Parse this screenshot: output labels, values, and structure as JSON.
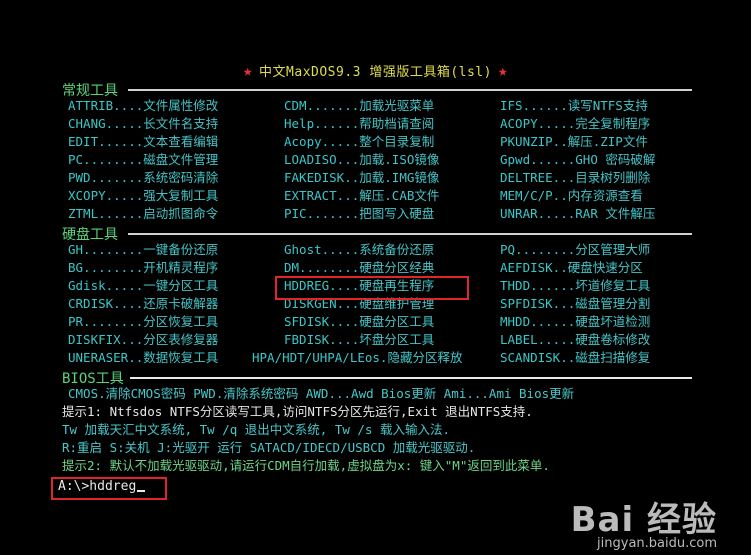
{
  "title": "中文MaxDOS9.3 增强版工具箱(lsl)",
  "sections": {
    "common": "常规工具",
    "disk": "硬盘工具",
    "bios": "BIOS工具"
  },
  "common_items": [
    {
      "k": "ATTRIB....",
      "d": "文件属性修改"
    },
    {
      "k": "CDM.......",
      "d": "加载光驱菜单"
    },
    {
      "k": "IFS......",
      "d": "读写NTFS支持"
    },
    {
      "k": "CHANG.....",
      "d": "长文件名支持"
    },
    {
      "k": "Help......",
      "d": "帮助档请查阅"
    },
    {
      "k": "ACOPY.....",
      "d": "完全复制程序"
    },
    {
      "k": "EDIT......",
      "d": "文本查看编辑"
    },
    {
      "k": "Acopy.....",
      "d": "整个目录复制"
    },
    {
      "k": "PKUNZIP..",
      "d": "解压.ZIP文件"
    },
    {
      "k": "PC........",
      "d": "磁盘文件管理"
    },
    {
      "k": "LOADISO...",
      "d": "加载.ISO镜像"
    },
    {
      "k": "Gpwd......",
      "d": "GHO 密码破解"
    },
    {
      "k": "PWD.......",
      "d": "系统密码清除"
    },
    {
      "k": "FAKEDISK..",
      "d": "加载.IMG镜像"
    },
    {
      "k": "DELTREE...",
      "d": "目录树列删除"
    },
    {
      "k": "XCOPY.....",
      "d": "强大复制工具"
    },
    {
      "k": "EXTRACT...",
      "d": "解压.CAB文件"
    },
    {
      "k": "MEM/C/P..",
      "d": "内存资源查看"
    },
    {
      "k": "ZTML......",
      "d": "启动抓图命令"
    },
    {
      "k": "PIC.......",
      "d": "把图写入硬盘"
    },
    {
      "k": "UNRAR.....",
      "d": "RAR 文件解压"
    }
  ],
  "disk_items": [
    {
      "k": "GH........",
      "d": "一键备份还原"
    },
    {
      "k": "Ghost.....",
      "d": "系统备份还原"
    },
    {
      "k": "PQ........",
      "d": "分区管理大师"
    },
    {
      "k": "BG........",
      "d": "开机精灵程序"
    },
    {
      "k": "DM........",
      "d": "硬盘分区经典"
    },
    {
      "k": "AEFDISK..",
      "d": "硬盘快速分区"
    },
    {
      "k": "Gdisk.....",
      "d": "一键分区工具"
    },
    {
      "k": "HDDREG....",
      "d": "硬盘再生程序"
    },
    {
      "k": "THDD......",
      "d": "坏道修复工具"
    },
    {
      "k": "CRDISK....",
      "d": "还原卡破解器"
    },
    {
      "k": "DISKGEN...",
      "d": "硬盘维护管理"
    },
    {
      "k": "SPFDISK...",
      "d": "磁盘管理分割"
    },
    {
      "k": "PR........",
      "d": "分区恢复工具"
    },
    {
      "k": "SFDISK....",
      "d": "硬盘分区工具"
    },
    {
      "k": "MHDD......",
      "d": "硬盘坏道检测"
    },
    {
      "k": "DISKFIX...",
      "d": "分区表修复器"
    },
    {
      "k": "FBDISK....",
      "d": "坏盘分区工具"
    },
    {
      "k": "LABEL.....",
      "d": "硬盘卷标修改"
    },
    {
      "k": "UNERASER..",
      "d": "数据恢复工具"
    },
    {
      "k": "HPA/HDT/UHPA/LEos.",
      "d": "隐藏分区释放"
    },
    {
      "k": "SCANDISK..",
      "d": "磁盘扫描修复"
    }
  ],
  "bios_line": "CMOS.清除CMOS密码  PWD.清除系统密码  AWD...Awd Bios更新  Ami...Ami Bios更新",
  "tips": {
    "tip1": "提示1: Ntfsdos  NTFS分区读写工具,访问NTFS分区先运行,Exit 退出NTFS支持.",
    "tw": " Tw  加载天汇中文系统, Tw /q 退出中文系统,  Tw /s 载入输入法.",
    "r": " R:重启   S:关机    J:光驱开    运行 SATACD/IDECD/USBCD 加载光驱驱动.",
    "tip2": "提示2: 默认不加载光驱驱动,请运行CDM自行加载,虚拟盘为x:  键入\"M\"返回到此菜单."
  },
  "prompt": "A:\\>hddreg",
  "watermark": {
    "brand": "Bai 经验",
    "url": "jingyan.baidu.com"
  },
  "colors": {
    "background": "#000000",
    "cyan": "#48c8cb",
    "green": "#59d47a",
    "title": "#e0dd4a",
    "highlight": "#e0242b"
  }
}
